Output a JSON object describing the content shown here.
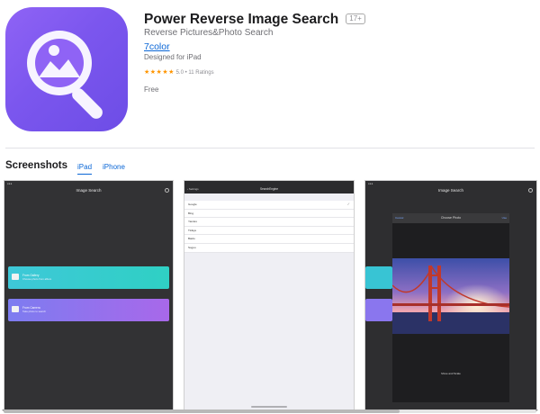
{
  "app": {
    "title": "Power Reverse Image Search",
    "age_rating": "17+",
    "subtitle": "Reverse Pictures&Photo Search",
    "developer": "7color",
    "designed_for": "Designed for iPad",
    "stars": "★★★★★",
    "rating_text": "5.0 • 11 Ratings",
    "price": "Free",
    "icon": "magnifier-photo-icon",
    "accent": "#7b56ee"
  },
  "screenshots": {
    "heading": "Screenshots",
    "tabs": [
      {
        "label": "iPad",
        "selected": true
      },
      {
        "label": "iPhone",
        "selected": false
      }
    ]
  },
  "shot1": {
    "nav_title": "Image Search",
    "gallery_label": "From Gallery",
    "gallery_sub": "Choose photo from album",
    "camera_label": "From Camera",
    "camera_sub": "Take photo to search"
  },
  "shot2": {
    "back": "‹ Settings",
    "nav_title": "SearchEngine",
    "engines": [
      "Google",
      "Bing",
      "Yandex",
      "TinEye",
      "Baidu",
      "Sogou"
    ],
    "selected": "Google"
  },
  "shot3": {
    "nav_title": "Image Search",
    "modal_title": "Choose Photo",
    "cancel": "Cancel",
    "use": "Use",
    "footer": "Move and Scale"
  },
  "scroll": {
    "position_fraction": 0.75
  }
}
